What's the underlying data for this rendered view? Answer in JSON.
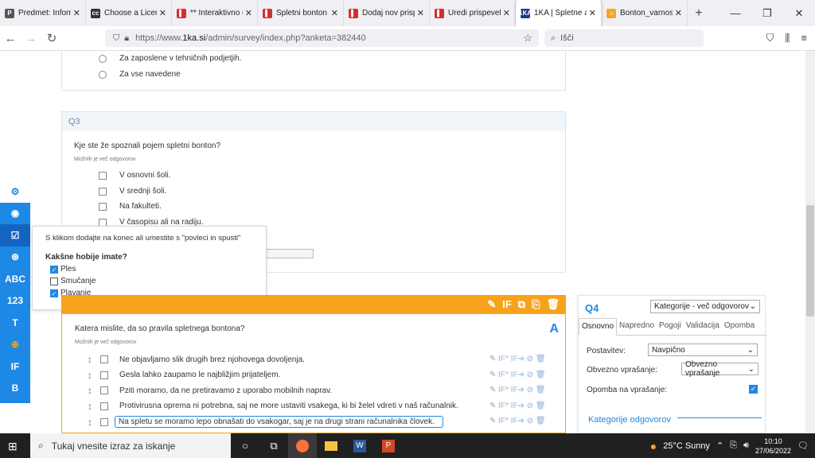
{
  "tabs": [
    {
      "label": "Predmet: Informacij",
      "fav": "P",
      "favColor": "#555"
    },
    {
      "label": "Choose a Licens",
      "fav": "cc",
      "favColor": "#333"
    },
    {
      "label": "** Interaktivno u",
      "fav": "▌",
      "favColor": "#d32f2f"
    },
    {
      "label": "Spletni bonton",
      "fav": "▌",
      "favColor": "#d32f2f"
    },
    {
      "label": "Dodaj nov prisp",
      "fav": "▌",
      "favColor": "#d32f2f"
    },
    {
      "label": "Uredi prispevek",
      "fav": "▌",
      "favColor": "#d32f2f"
    },
    {
      "label": "1KA | Spletne an",
      "fav": "1KA",
      "favColor": "#1e3a8a"
    },
    {
      "label": "Bonton_varnost",
      "fav": "☼",
      "favColor": "#f5a623"
    }
  ],
  "tab_close": "✕",
  "new_tab": "+",
  "url_prefix": "https://www.",
  "url_domain": "1ka.si",
  "url_rest": "/admin/survey/index.php?anketa=382440",
  "search_placeholder": "Išči",
  "q_prev": {
    "options": [
      "Za zaposlene v tehničnih podjetjih.",
      "Za vse navedene"
    ]
  },
  "q3": {
    "code": "Q3",
    "text": "Kje ste že spoznali pojem spletni bonton?",
    "hint": "Možnih je več odgovorov",
    "options": [
      "V osnovni šoli.",
      "V srednji šoli.",
      "Na fakulteti.",
      "V časopisu ali na radiju."
    ]
  },
  "sidebar": [
    "⚙",
    "◉",
    "☑",
    "⊛",
    "ABC",
    "123",
    "T",
    "⊕",
    "IF",
    "B"
  ],
  "popup": {
    "hint": "S klikom dodajte na konec ali umestite s \"povleci in spusti\"",
    "question": "Kakšne hobije imate?",
    "options": [
      {
        "label": "Ples",
        "checked": true
      },
      {
        "label": "Smučanje",
        "checked": false
      },
      {
        "label": "Plavanje",
        "checked": true
      }
    ]
  },
  "q4": {
    "text": "Katera mislite, da so pravila spletnega bontona?",
    "hint": "Možnih je več odgovorov",
    "options": [
      "Ne objavljamo slik drugih brez njohovega dovoljenja.",
      "Gesla lahko zaupamo le najbližjim prijateljem.",
      "Pziti moramo, da ne pretiravamo z uporabo mobilnih naprav.",
      "Protivirusna oprema ni potrebna, saj ne more ustaviti vsakega, ki bi želel vdreti v naš računalnik.",
      "Na spletu se moramo lepo obnašati do vsakogar, saj je na drugi strani računalnika človek."
    ],
    "font_icon": "A",
    "row_icons": "✎ IF* IF➜ ⊘ 🗑",
    "actions": [
      "✎",
      "IF",
      "⧉",
      "⎘",
      "🗑"
    ]
  },
  "panel": {
    "code": "Q4",
    "type": "Kategorije - več odgovorov",
    "tabs": [
      "Osnovno",
      "Napredno",
      "Pogoji",
      "Validacija",
      "Opomba"
    ],
    "postavitev_label": "Postavitev:",
    "postavitev_value": "Navpično",
    "obvezno_label": "Obvezno vprašanje:",
    "obvezno_value": "Obvezno vprašanje",
    "opomba_label": "Opomba na vprašanje:",
    "opomba_checked": true,
    "kategorije_label": "Kategorije odgovorov"
  },
  "taskbar": {
    "search": "Tukaj vnesite izraz za iskanje",
    "weather": "25°C  Sunny",
    "time": "10:10",
    "date": "27/06/2022"
  },
  "colors": {
    "accent": "#1e88e5",
    "orange": "#f7a21b"
  }
}
